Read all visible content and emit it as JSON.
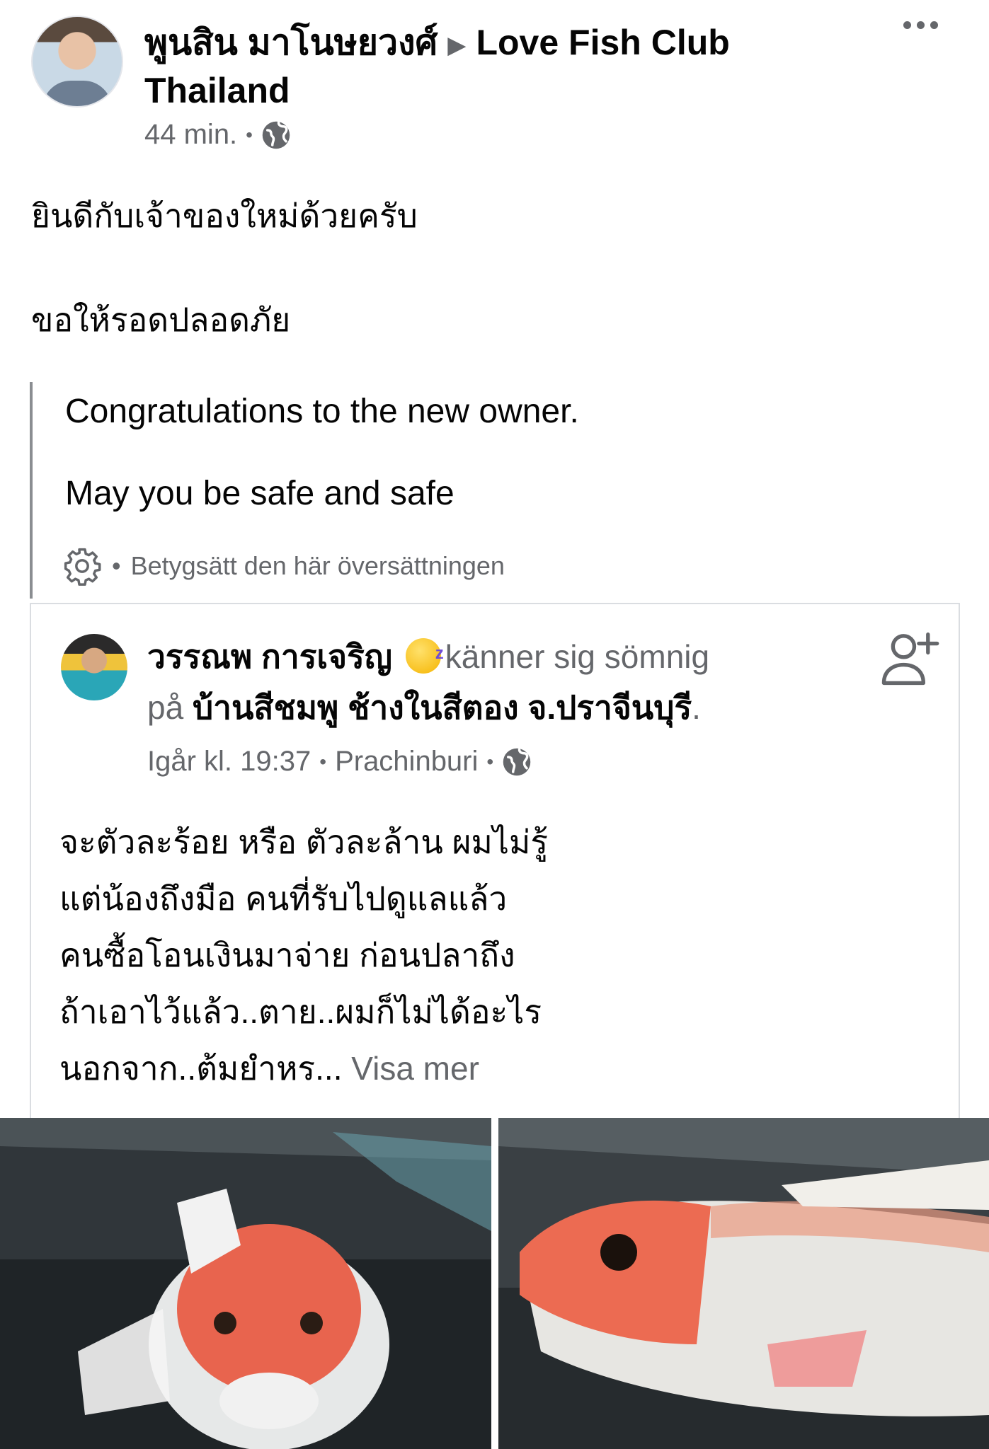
{
  "post": {
    "author": "พูนสิน มาโนษยวงศ์",
    "arrow": "▶",
    "group": "Love Fish Club Thailand",
    "time": "44 min.",
    "dot": "•",
    "text_line1": "ยินดีกับเจ้าของใหม่ด้วยครับ",
    "text_line2": "ขอให้รอดปลอดภัย",
    "translation_line1": "Congratulations to the new owner.",
    "translation_line2": "May you be safe and safe",
    "rate_translation": "Betygsätt den här översättningen"
  },
  "shared": {
    "author": "วรรณพ การเจริญ",
    "feeling": "känner sig sömnig",
    "at": "på",
    "place": "บ้านสีชมพู ช้างในสีตอง จ.ปราจีนบุรี",
    "period": ".",
    "time": "Igår kl. 19:37",
    "location": "Prachinburi",
    "dot": "•",
    "lines": [
      "จะตัวละร้อย หรือ ตัวละล้าน ผมไม่รู้",
      "แต่น้องถึงมือ คนที่รับไปดูแลแล้ว",
      "คนซื้อโอนเงินมาจ่าย ก่อนปลาถึง",
      "ถ้าเอาไว้แล้ว..ตาย..ผมก็ไม่ได้อะไร",
      "นอกจาก..ต้มยำหร..."
    ],
    "see_more": "Visa mer"
  },
  "icons": {
    "globe": "globe-icon",
    "more": "more-options-icon",
    "gear": "gear-icon",
    "add_friend": "add-friend-icon",
    "emoji": "sleepy-face-emoji"
  },
  "colors": {
    "text_primary": "#050505",
    "text_secondary": "#65676b",
    "border": "#dadde1"
  }
}
